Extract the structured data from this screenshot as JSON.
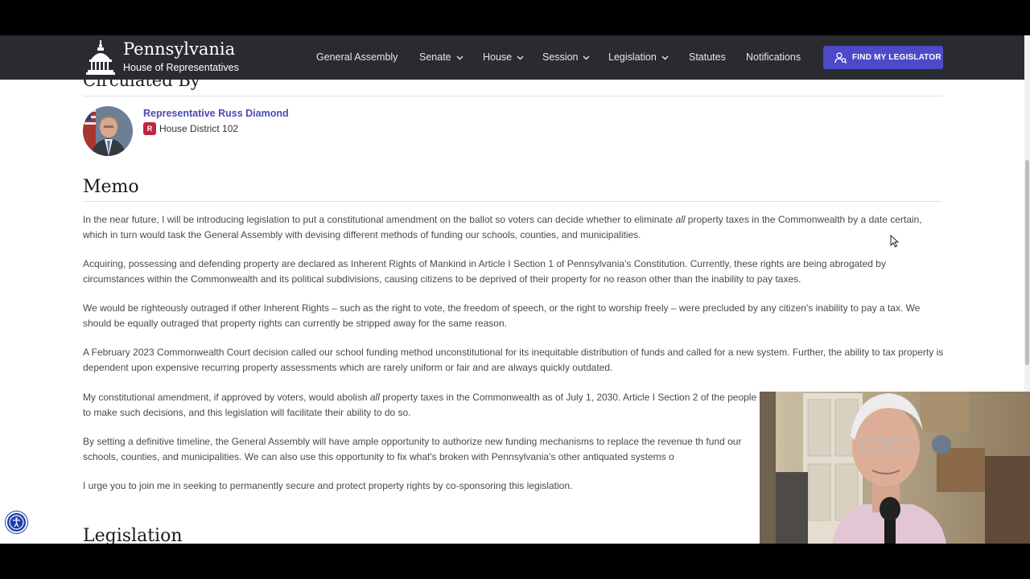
{
  "header": {
    "brand_title": "Pennsylvania",
    "brand_subtitle": "House of Representatives",
    "nav": [
      {
        "label": "General Assembly",
        "dropdown": false
      },
      {
        "label": "Senate",
        "dropdown": true
      },
      {
        "label": "House",
        "dropdown": true
      },
      {
        "label": "Session",
        "dropdown": true
      },
      {
        "label": "Legislation",
        "dropdown": true
      },
      {
        "label": "Statutes",
        "dropdown": false
      },
      {
        "label": "Notifications",
        "dropdown": false
      }
    ],
    "find_button_label": "FIND MY LEGISLATOR"
  },
  "circulated": {
    "heading": "Circulated By",
    "rep_name": "Representative Russ Diamond",
    "party": "R",
    "district": "House District 102"
  },
  "memo": {
    "heading": "Memo",
    "paragraphs": [
      {
        "before": "In the near future, I will be introducing legislation to put a constitutional amendment on the ballot so voters can decide whether to eliminate ",
        "em": "all",
        "after": " property taxes in the Commonwealth by a date certain, which in turn would task the General Assembly with devising different methods of funding our schools, counties, and municipalities."
      },
      {
        "before": "Acquiring, possessing and defending property are declared as Inherent Rights of Mankind in Article I Section 1 of Pennsylvania's Constitution. Currently, these rights are being abrogated by circumstances within the Commonwealth and its political subdivisions, causing citizens to be deprived of their property for no reason other than the inability to pay taxes.",
        "em": "",
        "after": ""
      },
      {
        "before": "We would be righteously outraged if other Inherent Rights – such as the right to vote, the freedom of speech, or the right to worship freely – were precluded by any citizen's inability to pay a tax. We should be equally outraged that property rights can currently be stripped away for the same reason.",
        "em": "",
        "after": ""
      },
      {
        "before": "A February 2023 Commonwealth Court decision called our school funding method unconstitutional for its inequitable distribution of funds and called for a new system. Further, the ability to tax property is dependent upon expensive recurring property assessments which are rarely uniform or fair and are always quickly outdated.",
        "em": "",
        "after": ""
      },
      {
        "before": "My constitutional amendment, if approved by voters, would abolish ",
        "em": "all",
        "after": " property taxes in the Commonwealth as of July 1, 2030. Article I Section 2 of the people to make such decisions, and this legislation will facilitate their ability to do so."
      },
      {
        "before": "By setting a definitive timeline, the General Assembly will have ample opportunity to authorize new funding mechanisms to replace the revenue th fund our schools, counties, and municipalities. We can also use this opportunity to fix what's broken with Pennsylvania's other antiquated systems o",
        "em": "",
        "after": ""
      },
      {
        "before": "I urge you to join me in seeking to permanently secure and protect property rights by co-sponsoring this legislation.",
        "em": "",
        "after": ""
      }
    ]
  },
  "legislation": {
    "heading": "Legislation"
  },
  "colors": {
    "nav_bg": "#2a2b30",
    "accent": "#4d4ac9",
    "link": "#4b48b5",
    "party_badge": "#c0253f"
  },
  "icons": {
    "logo": "capitol-dome-icon",
    "find": "person-search-icon",
    "dropdown": "chevron-down-icon",
    "accessibility": "accessibility-icon",
    "cursor": "mouse-pointer-icon"
  }
}
